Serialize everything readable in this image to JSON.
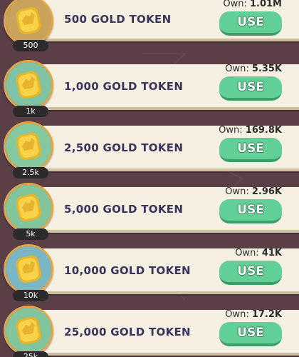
{
  "own_label": "Own:",
  "use_label": "USE",
  "tokens": [
    {
      "name": "500 GOLD TOKEN",
      "badge": "500",
      "own": "1.01M",
      "medal_color": "#c9a25c"
    },
    {
      "name": "1,000 GOLD TOKEN",
      "badge": "1k",
      "own": "5.35K",
      "medal_color": "#7fc2a4"
    },
    {
      "name": "2,500 GOLD TOKEN",
      "badge": "2.5k",
      "own": "169.8K",
      "medal_color": "#84c8a0"
    },
    {
      "name": "5,000 GOLD TOKEN",
      "badge": "5k",
      "own": "2.96K",
      "medal_color": "#82c49c"
    },
    {
      "name": "10,000 GOLD TOKEN",
      "badge": "10k",
      "own": "41K",
      "medal_color": "#7bb6c4"
    },
    {
      "name": "25,000 GOLD TOKEN",
      "badge": "25k",
      "own": "17.2K",
      "medal_color": "#82c49c"
    }
  ],
  "colors": {
    "background": "#5a3f47",
    "card": "#f5f0e2",
    "button": "#62cf97",
    "text": "#3a335a",
    "coin": "#f2c230"
  },
  "icons": {
    "coin": "gold-coin-icon"
  }
}
